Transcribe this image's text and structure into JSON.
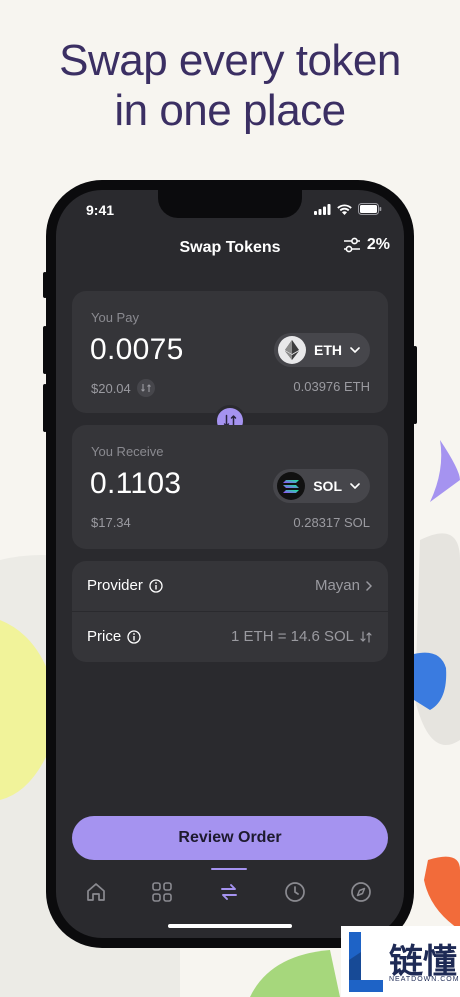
{
  "headline": {
    "line1": "Swap every token",
    "line2": "in one place"
  },
  "status_bar": {
    "time": "9:41"
  },
  "header": {
    "title": "Swap Tokens",
    "slippage": "2%"
  },
  "pay": {
    "label": "You Pay",
    "amount": "0.0075",
    "fiat": "$20.04",
    "token": "ETH",
    "balance": "0.03976 ETH"
  },
  "receive": {
    "label": "You Receive",
    "amount": "0.1103",
    "fiat": "$17.34",
    "token": "SOL",
    "balance": "0.28317 SOL"
  },
  "details": {
    "provider_label": "Provider",
    "provider_value": "Mayan",
    "price_label": "Price",
    "price_value": "1 ETH = 14.6 SOL"
  },
  "review_button": "Review Order",
  "nav": {
    "items": [
      "home-icon",
      "grid-icon",
      "swap-icon",
      "clock-icon",
      "compass-icon"
    ],
    "active": "swap-icon"
  },
  "watermark": {
    "text": "链懂",
    "sub": "NEATDOWN.COM"
  },
  "colors": {
    "accent": "#a593f0",
    "headline": "#3b2f63",
    "background": "#f7f5f0",
    "screen": "#2a2a2e",
    "card": "#353539"
  }
}
